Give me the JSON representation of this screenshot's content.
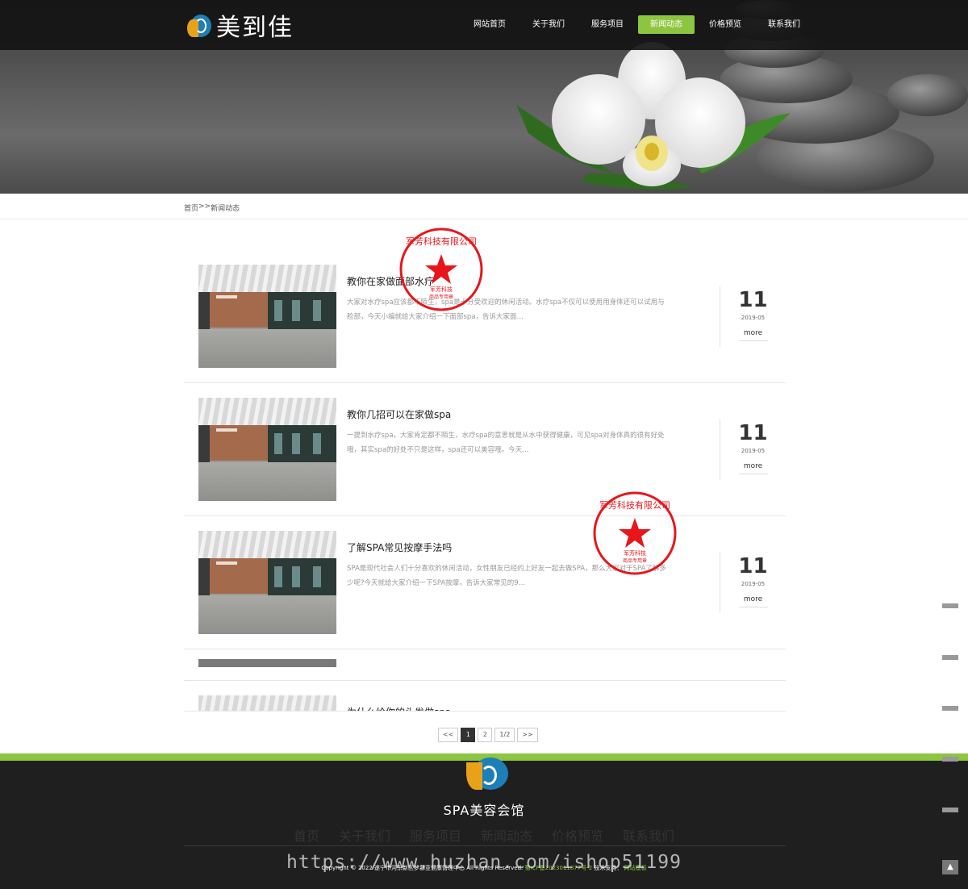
{
  "brand": {
    "logo_text": "美到佳"
  },
  "nav": {
    "items": [
      "网站首页",
      "关于我们",
      "服务项目",
      "新闻动态",
      "价格预览",
      "联系我们"
    ],
    "active_index": 3,
    "accent_color": "#8cc53f"
  },
  "breadcrumb": {
    "home": "首页",
    "separator": ">>",
    "current": "新闻动态"
  },
  "news": [
    {
      "title": "教你在家做面部水疗",
      "desc": "大家对水疗spa应该都不陌生，spa是十分受欢迎的休闲活动。水疗spa不仅可以使用用身体还可以试用与脸部，今天小编就给大家介绍一下面部spa，告诉大家面…",
      "day": "11",
      "ym": "2019-05",
      "more": "more"
    },
    {
      "title": "教你几招可以在家做spa",
      "desc": "一提到水疗spa，大家肯定都不陌生，水疗spa的意思就是从水中获得健康，可见spa对身体真的很有好处哦，其实spa的好处不只是这样，spa还可以美容哦。今天…",
      "day": "11",
      "ym": "2019-05",
      "more": "more"
    },
    {
      "title": "了解SPA常见按摩手法吗",
      "desc": "SPA是现代社会人们十分喜欢的休闲活动，女性朋友已经约上好友一起去做SPA，那么大家对于SPA了解多少呢?今天就给大家介绍一下SPA按摩，告诉大家常见的9…",
      "day": "11",
      "ym": "2019-05",
      "more": "more"
    },
    {
      "title": "为什么给你的头发做spa"
    }
  ],
  "pager": {
    "prev": "<<",
    "pages": [
      "1",
      "2"
    ],
    "current": "1",
    "info": "1/2",
    "next": ">>"
  },
  "stamp": {
    "company": "军芳科技有限公司",
    "line1": "军芳科技",
    "line2": "商品专用章"
  },
  "footer": {
    "name": "SPA美容会馆",
    "nav": [
      "首页",
      "关于我们",
      "服务项目",
      "新闻动态",
      "价格预览",
      "联系我们"
    ],
    "copyright": "Copyright © 2022 遂宁市河东新区梦慕亚健康管理中心 All Rights Reserved.",
    "icp": "蜀ICP备2023011877号-2",
    "support_label": "技术支持：",
    "support": "网站模板",
    "watermark": "https://www.huzhan.com/ishop51199"
  }
}
